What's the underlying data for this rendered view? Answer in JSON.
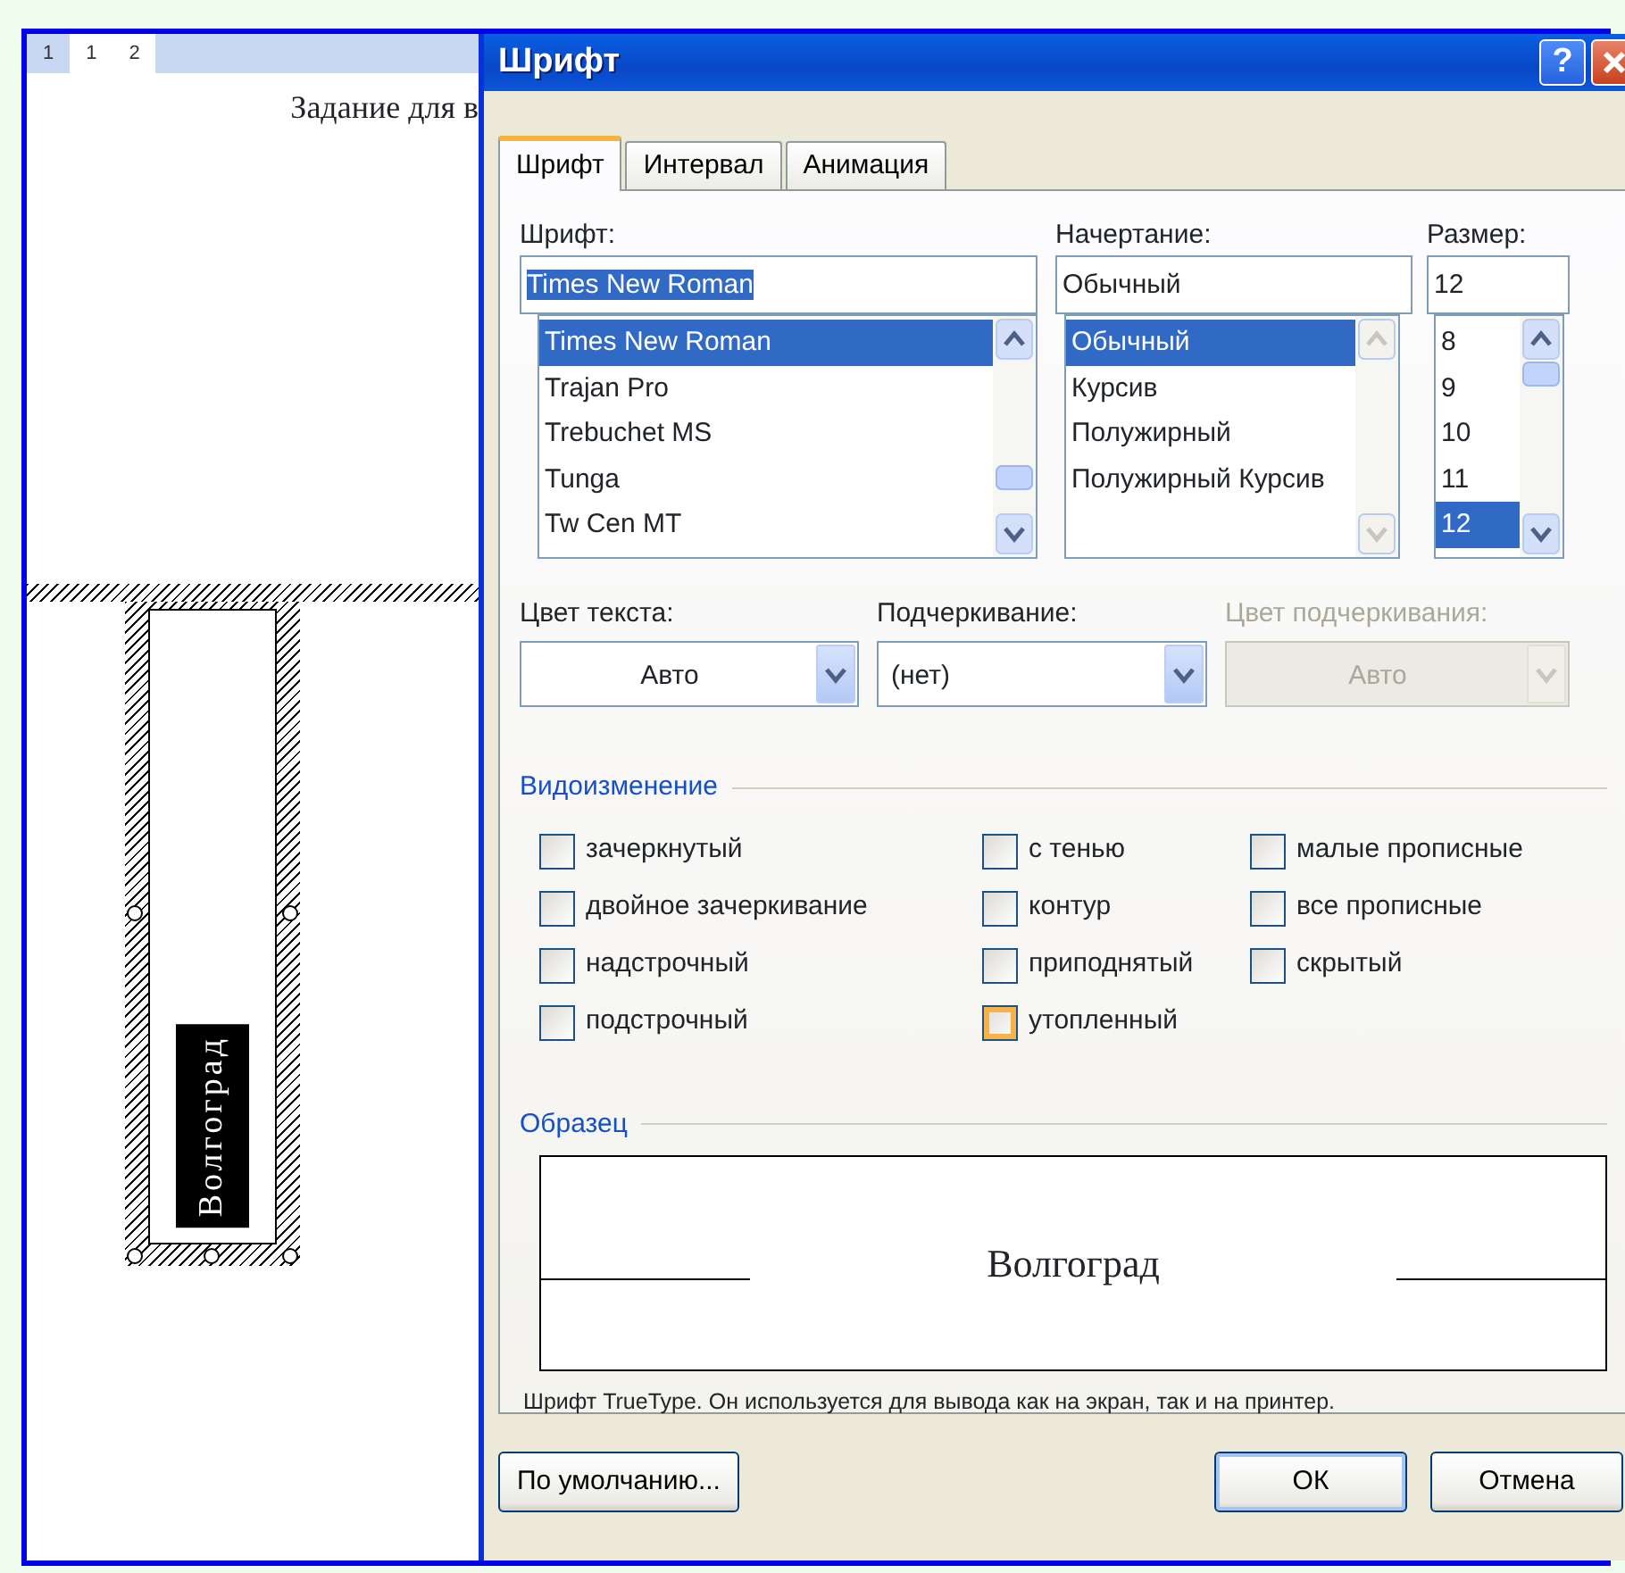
{
  "document": {
    "ruler": [
      "1",
      "1",
      "2"
    ],
    "heading": "Задание для в",
    "text_box": {
      "text": "Волгоград"
    }
  },
  "dialog": {
    "title": "Шрифт",
    "help_button": "?",
    "tabs": [
      {
        "label": "Шрифт",
        "selected": true
      },
      {
        "label": "Интервал",
        "selected": false
      },
      {
        "label": "Анимация",
        "selected": false
      }
    ],
    "font": {
      "label": "Шрифт:",
      "value": "Times New Roman",
      "value_highlighted": true,
      "items": [
        {
          "text": "Times New Roman",
          "selected": true
        },
        {
          "text": "Trajan Pro",
          "selected": false
        },
        {
          "text": "Trebuchet MS",
          "selected": false
        },
        {
          "text": "Tunga",
          "selected": false
        },
        {
          "text": "Tw Cen MT",
          "selected": false
        }
      ]
    },
    "style": {
      "label": "Начертание:",
      "value": "Обычный",
      "items": [
        {
          "text": "Обычный",
          "selected": true
        },
        {
          "text": "Курсив",
          "selected": false
        },
        {
          "text": "Полужирный",
          "selected": false
        },
        {
          "text": "Полужирный Курсив",
          "selected": false
        }
      ]
    },
    "size": {
      "label": "Размер:",
      "value": "12",
      "items": [
        {
          "text": "8",
          "selected": false
        },
        {
          "text": "9",
          "selected": false
        },
        {
          "text": "10",
          "selected": false
        },
        {
          "text": "11",
          "selected": false
        },
        {
          "text": "12",
          "selected": true
        }
      ]
    },
    "combos": [
      {
        "label": "Цвет текста:",
        "value": "Авто",
        "centered": true,
        "disabled": false
      },
      {
        "label": "Подчеркивание:",
        "value": "(нет)",
        "centered": false,
        "disabled": false
      },
      {
        "label": "Цвет подчеркивания:",
        "value": "Авто",
        "centered": true,
        "disabled": true
      }
    ],
    "effects": {
      "title": "Видоизменение",
      "columns": [
        [
          {
            "label": "зачеркнутый",
            "checked": false,
            "hover": false
          },
          {
            "label": "двойное зачеркивание",
            "checked": false,
            "hover": false
          },
          {
            "label": "надстрочный",
            "checked": false,
            "hover": false
          },
          {
            "label": "подстрочный",
            "checked": false,
            "hover": false
          }
        ],
        [
          {
            "label": "с тенью",
            "checked": false,
            "hover": false
          },
          {
            "label": "контур",
            "checked": false,
            "hover": false
          },
          {
            "label": "приподнятый",
            "checked": false,
            "hover": false
          },
          {
            "label": "утопленный",
            "checked": false,
            "hover": true
          }
        ],
        [
          {
            "label": "малые прописные",
            "checked": false,
            "hover": false
          },
          {
            "label": "все прописные",
            "checked": false,
            "hover": false
          },
          {
            "label": "скрытый",
            "checked": false,
            "hover": false
          }
        ]
      ]
    },
    "preview": {
      "title": "Образец",
      "text": "Волгоград"
    },
    "note": "Шрифт TrueType. Он используется для вывода как на экран, так и на принтер.",
    "buttons": [
      {
        "label": "По умолчанию...",
        "default": false
      },
      {
        "label": "ОК",
        "default": true
      },
      {
        "label": "Отмена",
        "default": false
      }
    ]
  }
}
